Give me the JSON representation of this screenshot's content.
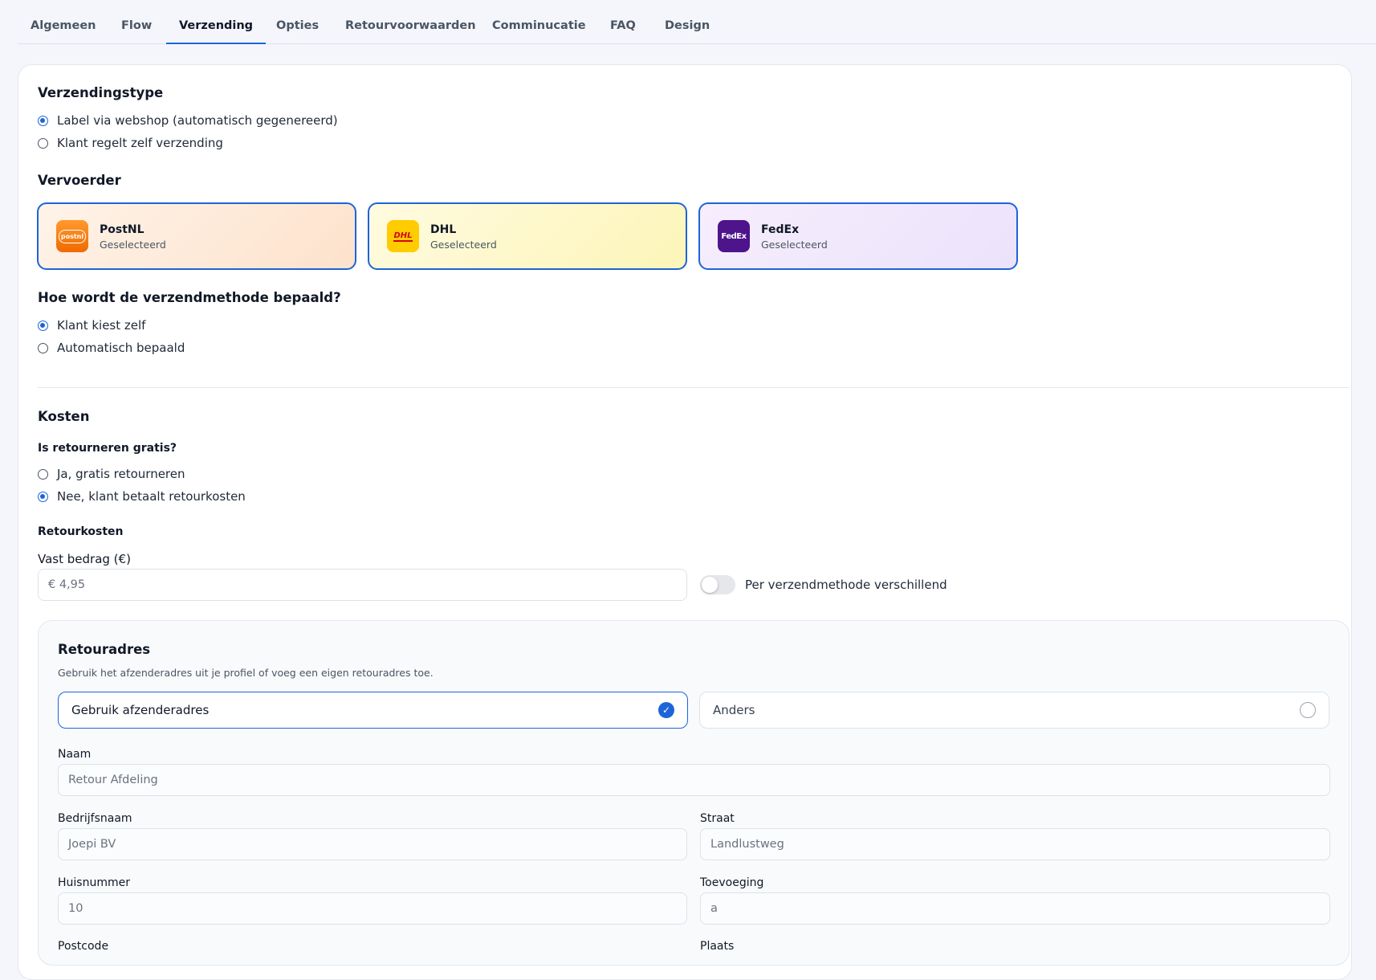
{
  "tabs": [
    {
      "label": "Algemeen"
    },
    {
      "label": "Flow"
    },
    {
      "label": "Verzending"
    },
    {
      "label": "Opties"
    },
    {
      "label": "Retourvoorwaarden"
    },
    {
      "label": "Comminucatie"
    },
    {
      "label": "FAQ"
    },
    {
      "label": "Design"
    }
  ],
  "active_tab": "Verzending",
  "shipping_type": {
    "title": "Verzendingstype",
    "options": [
      {
        "label": "Label via webshop (automatisch gegenereerd)",
        "selected": true
      },
      {
        "label": "Klant regelt zelf verzending",
        "selected": false
      }
    ]
  },
  "carrier": {
    "title": "Vervoerder",
    "items": [
      {
        "name": "PostNL",
        "status": "Geselecteerd",
        "logo_text": "postnl",
        "color": "#f58220"
      },
      {
        "name": "DHL",
        "status": "Geselecteerd",
        "logo_text": "DHL",
        "color": "#ffcc00"
      },
      {
        "name": "FedEx",
        "status": "Geselecteerd",
        "logo_text": "FedEx",
        "color": "#4d148c"
      }
    ]
  },
  "method": {
    "title": "Hoe wordt de verzendmethode bepaald?",
    "options": [
      {
        "label": "Klant kiest zelf",
        "selected": true
      },
      {
        "label": "Automatisch bepaald",
        "selected": false
      }
    ]
  },
  "costs": {
    "title": "Kosten",
    "free_question": "Is retourneren gratis?",
    "options": [
      {
        "label": "Ja, gratis retourneren",
        "selected": false
      },
      {
        "label": "Nee, klant betaalt retourkosten",
        "selected": true
      }
    ],
    "retourkosten_label": "Retourkosten",
    "fixed_label": "Vast bedrag (€)",
    "fixed_value": "€  4,95",
    "toggle_label": "Per verzendmethode verschillend",
    "toggle_on": false
  },
  "return_address": {
    "title": "Retouradres",
    "description": "Gebruik het afzenderadres uit je profiel of voeg een eigen retouradres toe.",
    "choices": [
      {
        "label": "Gebruik afzenderadres",
        "selected": true
      },
      {
        "label": "Anders",
        "selected": false
      }
    ],
    "fields": {
      "naam": {
        "label": "Naam",
        "value": "Retour Afdeling"
      },
      "bedrijfsnaam": {
        "label": "Bedrijfsnaam",
        "value": "Joepi BV"
      },
      "straat": {
        "label": "Straat",
        "value": "Landlustweg"
      },
      "huisnummer": {
        "label": "Huisnummer",
        "value": "10"
      },
      "toevoeging": {
        "label": "Toevoeging",
        "value": "a"
      },
      "postcode": {
        "label": "Postcode"
      },
      "plaats": {
        "label": "Plaats"
      }
    }
  },
  "colors": {
    "accent": "#1d64d8",
    "background": "#f4f6fb"
  }
}
